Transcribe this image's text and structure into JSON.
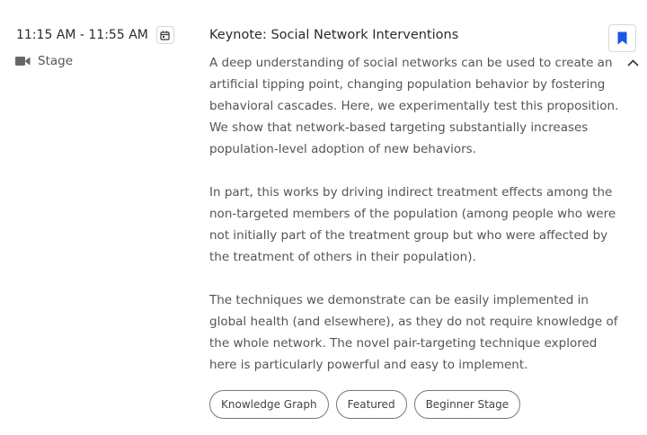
{
  "session": {
    "time_range": "11:15 AM - 11:55 AM",
    "location_icon": "video-camera-icon",
    "location": "Stage",
    "title": "Keynote: Social Network Interventions",
    "description": [
      "A deep understanding of social networks can be used to create an artificial tipping point, changing population behavior by fostering behavioral cascades. Here, we experimentally test this proposition. We show that network-based targeting substantially increases population-level adoption of new behaviors.",
      "In part, this works by driving indirect treatment effects among the non-targeted members of the population (among people who were not initially part of the treatment group but who were affected by the treatment of others in their population).",
      "The techniques we demonstrate can be easily implemented in global health (and elsewhere), as they do not require knowledge of the whole network. The novel pair-targeting technique explored here is particularly powerful and easy to implement."
    ],
    "tags": [
      "Knowledge Graph",
      "Featured",
      "Beginner Stage"
    ],
    "bookmarked": true
  },
  "colors": {
    "accent": "#1a56e8",
    "text": "#2b2b2b",
    "muted": "#555555",
    "border": "#d8d8d8"
  }
}
